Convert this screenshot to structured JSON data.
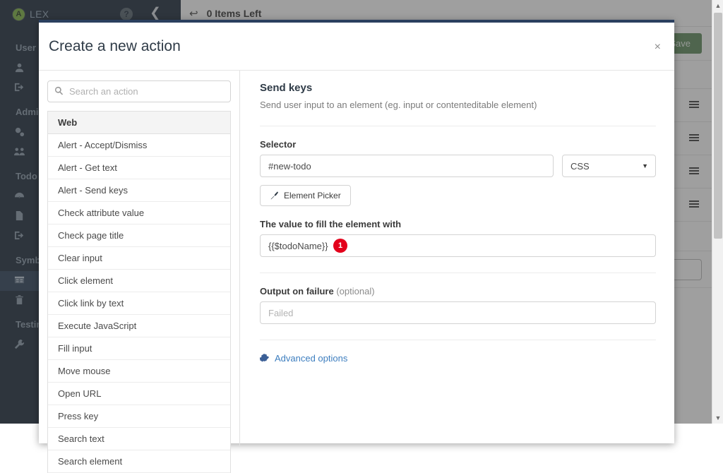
{
  "topbar": {
    "logo_initial": "A",
    "brand": "LEX",
    "help_label": "?",
    "collapse_icon": "chevron-left-icon"
  },
  "contentbar": {
    "back_icon": "back-arrow-icon",
    "title": "0 Items Left"
  },
  "sidebar": {
    "groups": [
      {
        "label": "User",
        "items": [
          {
            "icon": "user-icon",
            "name": "sidebar-item-profile"
          },
          {
            "icon": "logout-icon",
            "name": "sidebar-item-logout"
          }
        ]
      },
      {
        "label": "Admin",
        "items": [
          {
            "icon": "cogs-icon",
            "name": "sidebar-item-settings"
          },
          {
            "icon": "users-icon",
            "name": "sidebar-item-users"
          }
        ]
      },
      {
        "label": "Todo",
        "items": [
          {
            "icon": "dashboard-icon",
            "name": "sidebar-item-dashboard"
          },
          {
            "icon": "file-icon",
            "name": "sidebar-item-pages"
          },
          {
            "icon": "logout-icon",
            "name": "sidebar-item-exit"
          }
        ]
      },
      {
        "label": "Symbols",
        "items": [
          {
            "icon": "list-icon",
            "name": "sidebar-item-symbols",
            "active": true
          },
          {
            "icon": "trash-icon",
            "name": "sidebar-item-trash"
          }
        ]
      },
      {
        "label": "Testing",
        "items": [
          {
            "icon": "wrench-icon",
            "name": "sidebar-item-tools"
          }
        ]
      }
    ]
  },
  "page": {
    "save_label": "Save",
    "todo_rows": 4
  },
  "modal": {
    "title": "Create a new action",
    "close_label": "×",
    "search": {
      "placeholder": "Search an action",
      "value": "",
      "icon": "search-icon"
    },
    "action_list": {
      "group_label": "Web",
      "items": [
        "Alert - Accept/Dismiss",
        "Alert - Get text",
        "Alert - Send keys",
        "Check attribute value",
        "Check page title",
        "Clear input",
        "Click element",
        "Click link by text",
        "Execute JavaScript",
        "Fill input",
        "Move mouse",
        "Open URL",
        "Press key",
        "Search text",
        "Search element"
      ]
    },
    "detail": {
      "title": "Send keys",
      "description": "Send user input to an element (eg. input or contenteditable element)",
      "selector_label": "Selector",
      "selector_value": "#new-todo",
      "selector_type": "CSS",
      "selector_type_caret": "▼",
      "element_picker_label": "Element Picker",
      "element_picker_icon": "pencil-icon",
      "value_label": "The value to fill the element with",
      "value_value": "{{$todoName}}",
      "value_badge": "1",
      "output_label": "Output on failure",
      "output_label_optional": "(optional)",
      "output_placeholder": "Failed",
      "output_value": "",
      "advanced_label": "Advanced options",
      "advanced_icon": "gear-icon"
    }
  },
  "scrollbar": {
    "up_arrow": "▲",
    "down_arrow": "▼"
  },
  "colors": {
    "sidebar_bg": "#1d2a3a",
    "modal_border": "#2a3f5f",
    "accent_link": "#3d7ebf",
    "badge_red": "#e3001b",
    "save_green": "#5f8a5c",
    "logo_green": "#7cb342"
  }
}
